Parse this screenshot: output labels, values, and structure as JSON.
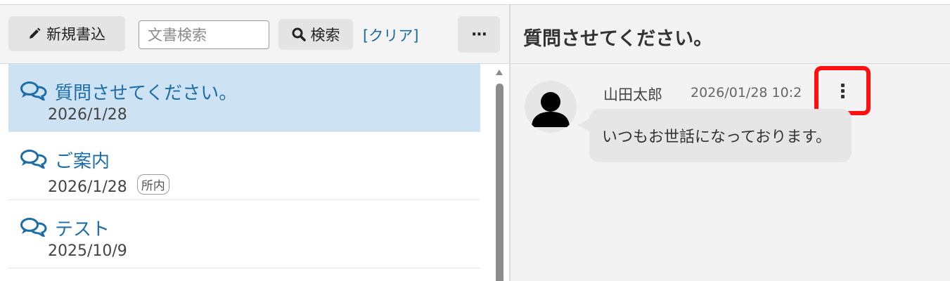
{
  "toolbar": {
    "new_label": "新規書込",
    "search_placeholder": "文書検索",
    "search_label": "検索",
    "clear_label": "[クリア]",
    "more_label": "···"
  },
  "threads": [
    {
      "title": "質問させてください。",
      "date": "2026/1/28",
      "badge": "",
      "selected": true
    },
    {
      "title": "ご案内",
      "date": "2026/1/28",
      "badge": "所内",
      "selected": false
    },
    {
      "title": "テスト",
      "date": "2025/10/9",
      "badge": "",
      "selected": false
    }
  ],
  "detail": {
    "title": "質問させてください。",
    "message": {
      "author": "山田太郎",
      "time": "2026/01/28 10:2",
      "text": "いつもお世話になっております。"
    }
  },
  "colors": {
    "accent": "#1d6ea8",
    "selected_bg": "#cde2f3",
    "highlight": "#ff1010"
  },
  "icons": {
    "new": "pencil-icon",
    "search": "magnifier-icon",
    "thread": "comments-icon",
    "menu": "vertical-ellipsis-icon",
    "avatar": "user-silhouette-icon"
  }
}
